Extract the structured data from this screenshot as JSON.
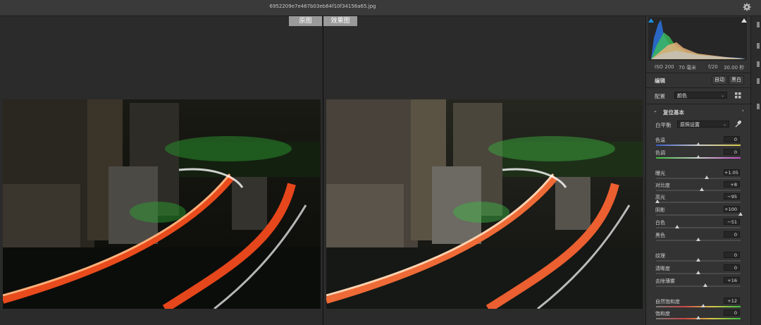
{
  "window": {
    "filename": "6952209e7e467b03eb64f10f34156a65.jpg"
  },
  "view": {
    "before_label": "原图",
    "after_label": "效果图"
  },
  "camera_info": {
    "iso": "ISO 200",
    "focal": "70 毫米",
    "aperture": "f/20",
    "shutter": "30.00 秒"
  },
  "edit": {
    "title": "编辑",
    "auto_label": "自动",
    "bw_label": "黑白"
  },
  "profile": {
    "label": "配置",
    "value": "颜色"
  },
  "section": {
    "title": "复位基本"
  },
  "white_balance": {
    "label": "白平衡",
    "value": "原照设置"
  },
  "sliders": [
    {
      "label": "色温",
      "value": "0",
      "pos": 0.5
    },
    {
      "label": "色调",
      "value": "0",
      "pos": 0.5
    },
    {
      "label": "曝光",
      "value": "+1.05",
      "pos": 0.6
    },
    {
      "label": "对比度",
      "value": "+8",
      "pos": 0.54
    },
    {
      "label": "高光",
      "value": "−95",
      "pos": 0.02
    },
    {
      "label": "阴影",
      "value": "+100",
      "pos": 1.0
    },
    {
      "label": "白色",
      "value": "−51",
      "pos": 0.25
    },
    {
      "label": "黑色",
      "value": "0",
      "pos": 0.5
    },
    {
      "label": "纹理",
      "value": "0",
      "pos": 0.5
    },
    {
      "label": "清晰度",
      "value": "0",
      "pos": 0.5
    },
    {
      "label": "去除薄雾",
      "value": "+16",
      "pos": 0.58
    },
    {
      "label": "自然饱和度",
      "value": "+12",
      "pos": 0.56
    },
    {
      "label": "饱和度",
      "value": "0",
      "pos": 0.5
    }
  ],
  "colors": {
    "accent": "#1e8fe1",
    "panel": "#333333",
    "canvas": "#2b2b2b"
  }
}
